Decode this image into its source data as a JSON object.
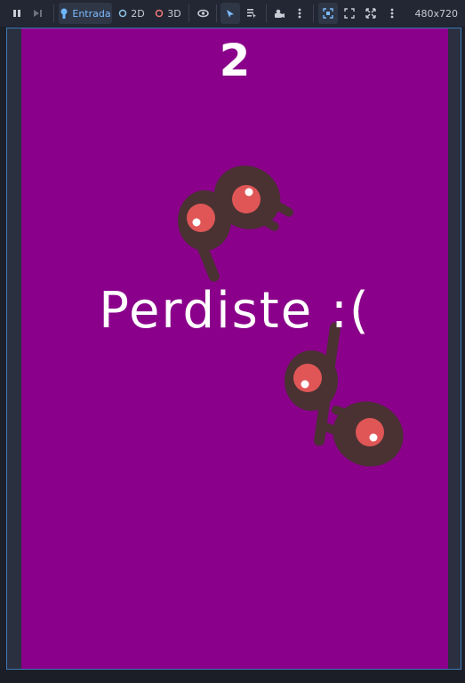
{
  "toolbar": {
    "entrada_label": "Entrada",
    "mode_2d_label": "2D",
    "mode_3d_label": "3D",
    "resolution": "480x720",
    "icons": [
      "pause-icon",
      "step-icon",
      "input-icon",
      "eye-icon",
      "select-arrow-icon",
      "list-select-icon",
      "camera-icon",
      "more-icon",
      "frame-icon",
      "expand-icon",
      "fullscreen-icon",
      "more-icon"
    ]
  },
  "game": {
    "score": "2",
    "message": "Perdiste :(",
    "background_color": "#8a008a",
    "character_colors": {
      "body": "#4a3232",
      "eye": "#e05656",
      "pupil": "#ffffff"
    }
  }
}
